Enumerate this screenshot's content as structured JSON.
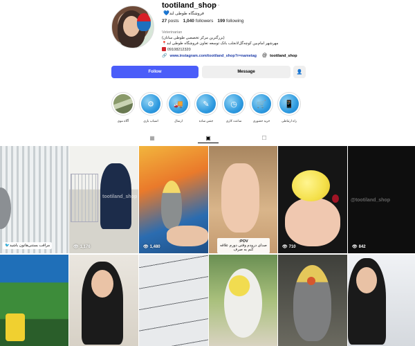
{
  "profile": {
    "username": "tootiland_shop",
    "more_icon": "…",
    "full_name": "فروشگاه طوطی لند",
    "name_heart": "💙",
    "stats": {
      "posts_count": "27",
      "posts_label": "posts",
      "followers_count": "1,040",
      "followers_label": "followers",
      "following_count": "199",
      "following_label": "following"
    },
    "category": "Veterinarian",
    "bio_line1": "(بزرگترین مرکز تخصصی طوطی سانان)",
    "bio_line2": "📍مهرشهر امام‌بین کوچه‌گل‌لانجلب بانک توسعه تعاون فروشگاه طوطی لند",
    "bio_phone": "09108212320",
    "link_url": "www.instagram.com/tootiland_shop?r=nametag",
    "threads_handle": "tootiland_shop"
  },
  "actions": {
    "follow_label": "Follow",
    "message_label": "Message",
    "suggest_icon": "add-user-icon"
  },
  "highlights": [
    {
      "label": "آگاه موی"
    },
    {
      "label": "اسباب بازی"
    },
    {
      "label": "ارسال"
    },
    {
      "label": "جنس ساده"
    },
    {
      "label": "ساعت کاری"
    },
    {
      "label": "خرید حضوری"
    },
    {
      "label": "راه ارتباطی"
    }
  ],
  "tabs": [
    {
      "name": "posts",
      "icon": "grid-icon"
    },
    {
      "name": "reels",
      "icon": "reels-icon"
    },
    {
      "name": "tagged",
      "icon": "tagged-icon"
    }
  ],
  "grid": {
    "row1": [
      {
        "views": "",
        "caption": "مراقب بستنی‌هاتون باشید🐦"
      },
      {
        "views": "1,176",
        "watermark": "tootiland_shop"
      },
      {
        "views": "1,480"
      },
      {
        "views": "",
        "caption_title": "POV:",
        "caption": "صدای درودم وقتی دورم علاقه کنم به صرف"
      },
      {
        "views": "710"
      },
      {
        "views": "842",
        "watermark": "@tootiland_shop"
      }
    ]
  },
  "colors": {
    "follow_bg": "#4a5df9",
    "link": "#1d3ba8",
    "highlight_blue": "#2f9be0"
  }
}
